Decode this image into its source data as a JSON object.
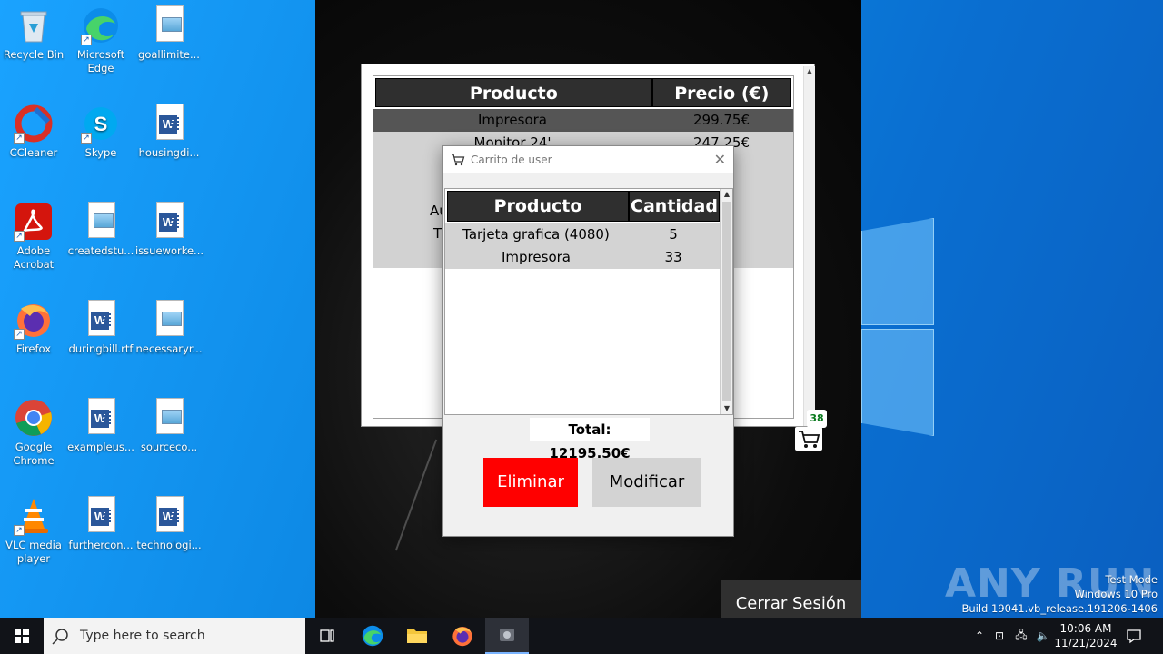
{
  "desktop": {
    "icons": [
      {
        "label": "Recycle Bin",
        "icon": "recycle-bin-icon"
      },
      {
        "label": "Microsoft Edge",
        "icon": "edge-icon"
      },
      {
        "label": "goallimite...",
        "icon": "image-file-icon"
      },
      {
        "label": "CCleaner",
        "icon": "ccleaner-icon"
      },
      {
        "label": "Skype",
        "icon": "skype-icon"
      },
      {
        "label": "housingdi...",
        "icon": "word-doc-icon"
      },
      {
        "label": "Adobe Acrobat",
        "icon": "acrobat-icon"
      },
      {
        "label": "createdstu...",
        "icon": "image-file-icon"
      },
      {
        "label": "issueworke...",
        "icon": "word-doc-icon"
      },
      {
        "label": "Firefox",
        "icon": "firefox-icon"
      },
      {
        "label": "duringbill.rtf",
        "icon": "word-doc-icon"
      },
      {
        "label": "necessaryr...",
        "icon": "image-file-icon"
      },
      {
        "label": "Google Chrome",
        "icon": "chrome-icon"
      },
      {
        "label": "exampleus...",
        "icon": "word-doc-icon"
      },
      {
        "label": "sourceco...",
        "icon": "image-file-icon"
      },
      {
        "label": "VLC media player",
        "icon": "vlc-icon"
      },
      {
        "label": "furthercon...",
        "icon": "word-doc-icon"
      },
      {
        "label": "technologi...",
        "icon": "word-doc-icon"
      }
    ]
  },
  "products": {
    "headers": [
      "Producto",
      "Precio (€)"
    ],
    "rows": [
      {
        "name": "Impresora",
        "price": "299.75€"
      },
      {
        "name": "Monitor 24'",
        "price": "247.25€"
      },
      {
        "name": "",
        "price": "€"
      },
      {
        "name": "",
        "price": "€"
      },
      {
        "name": "Au",
        "price": "€"
      },
      {
        "name": "T",
        "price": "5€"
      },
      {
        "name": "",
        "price": "€"
      }
    ],
    "cart_count": "38"
  },
  "cart_dialog": {
    "title": "Carrito de user",
    "headers": [
      "Producto",
      "Cantidad"
    ],
    "rows": [
      {
        "product": "Tarjeta grafica (4080)",
        "qty": "5"
      },
      {
        "product": "Impresora",
        "qty": "33"
      }
    ],
    "total": "Total: 12195.50€",
    "delete_label": "Eliminar",
    "modify_label": "Modificar"
  },
  "logout_label": "Cerrar Sesión",
  "watermark": {
    "brand": "ANY RUN",
    "line1": "Test Mode",
    "line2": "Windows 10 Pro",
    "line3": "Build 19041.vb_release.191206-1406"
  },
  "taskbar": {
    "search_placeholder": "Type here to search",
    "time": "10:06 AM",
    "date": "11/21/2024"
  },
  "colors": {
    "delete_button": "#ff0000",
    "header_bg": "#2f2f2f",
    "badge_text": "#0a7a1e"
  }
}
